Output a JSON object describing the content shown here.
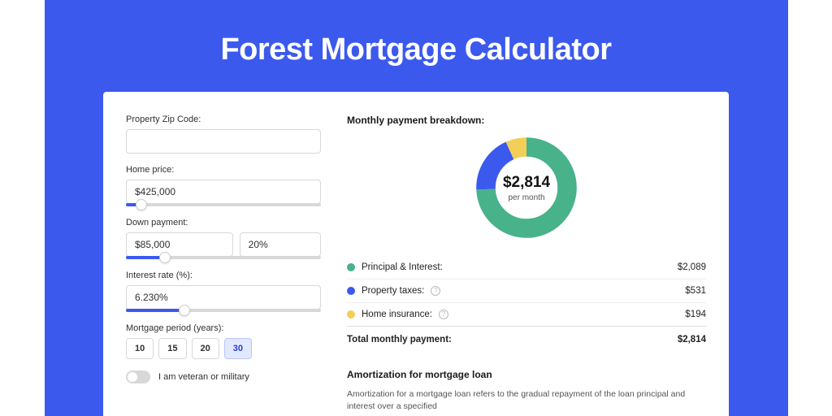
{
  "header": {
    "title": "Forest Mortgage Calculator"
  },
  "form": {
    "zip": {
      "label": "Property Zip Code:",
      "value": ""
    },
    "home_price": {
      "label": "Home price:",
      "value": "$425,000",
      "slider_pct": 8
    },
    "down_payment": {
      "label": "Down payment:",
      "value": "$85,000",
      "pct_value": "20%",
      "slider_pct": 20
    },
    "interest_rate": {
      "label": "Interest rate (%):",
      "value": "6.230%",
      "slider_pct": 30
    },
    "period": {
      "label": "Mortgage period (years):",
      "options": [
        "10",
        "15",
        "20",
        "30"
      ],
      "selected": "30"
    },
    "veteran": {
      "label": "I am veteran or military",
      "checked": false
    }
  },
  "breakdown": {
    "title": "Monthly payment breakdown:",
    "center_amount": "$2,814",
    "center_sub": "per month",
    "items": [
      {
        "label": "Principal & Interest:",
        "value": "$2,089",
        "color": "#48b28a",
        "help": false
      },
      {
        "label": "Property taxes:",
        "value": "$531",
        "color": "#3c59ee",
        "help": true
      },
      {
        "label": "Home insurance:",
        "value": "$194",
        "color": "#f3cf57",
        "help": true
      }
    ],
    "total": {
      "label": "Total monthly payment:",
      "value": "$2,814"
    }
  },
  "chart_data": {
    "type": "pie",
    "title": "Monthly payment breakdown",
    "categories": [
      "Principal & Interest",
      "Property taxes",
      "Home insurance"
    ],
    "values": [
      2089,
      531,
      194
    ],
    "colors": [
      "#48b28a",
      "#3c59ee",
      "#f3cf57"
    ],
    "center_label": "$2,814 per month"
  },
  "amortization": {
    "title": "Amortization for mortgage loan",
    "text": "Amortization for a mortgage loan refers to the gradual repayment of the loan principal and interest over a specified"
  }
}
